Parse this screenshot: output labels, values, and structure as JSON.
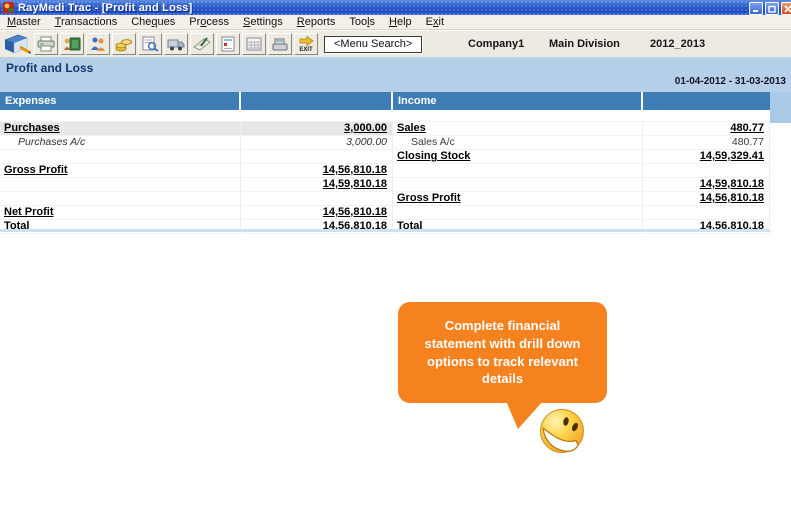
{
  "window": {
    "title": "RayMedi Trac - [Profit and Loss]"
  },
  "menu": {
    "items": [
      {
        "label": "Master",
        "accel": 0
      },
      {
        "label": "Transactions",
        "accel": 0
      },
      {
        "label": "Cheques",
        "accel": 3
      },
      {
        "label": "Process",
        "accel": 2
      },
      {
        "label": "Settings",
        "accel": 0
      },
      {
        "label": "Reports",
        "accel": 0
      },
      {
        "label": "Tools",
        "accel": 3
      },
      {
        "label": "Help",
        "accel": 0
      },
      {
        "label": "Exit",
        "accel": 1
      }
    ]
  },
  "toolbar": {
    "buttons": [
      "ledger-book",
      "print",
      "cash-payment",
      "customers",
      "money-bag",
      "search-document",
      "delivery-truck",
      "cheque-writing",
      "report-document",
      "calendar",
      "cash-register",
      "exit"
    ],
    "exit_label": "EXIT",
    "menu_search_label": "<Menu Search>",
    "company": "Company1",
    "division": "Main Division",
    "fiscal_year": "2012_2013"
  },
  "report": {
    "title": "Profit and Loss",
    "period": "01-04-2012 - 31-03-2013",
    "columns": {
      "expenses": "Expenses",
      "income": "Income"
    },
    "rows": [
      {
        "left": {
          "label": "Purchases",
          "value": "3,000.00",
          "style": "link",
          "highlight": true
        },
        "right": {
          "label": "Sales",
          "value": "480.77",
          "style": "link"
        }
      },
      {
        "left": {
          "label": "Purchases A/c",
          "value": "3,000.00",
          "style": "sub-italic"
        },
        "right": {
          "label": "Sales A/c",
          "value": "480.77",
          "style": "sub"
        }
      },
      {
        "left": null,
        "right": {
          "label": "Closing Stock",
          "value": "14,59,329.41",
          "style": "link"
        }
      },
      {
        "left": {
          "label": "Gross Profit",
          "value": "14,56,810.18",
          "style": "link"
        },
        "right": null
      },
      {
        "left": {
          "label": "",
          "value": "14,59,810.18",
          "style": "link"
        },
        "right": {
          "label": "",
          "value": "14,59,810.18",
          "style": "link"
        }
      },
      {
        "left": null,
        "right": {
          "label": "Gross Profit",
          "value": "14,56,810.18",
          "style": "link"
        }
      },
      {
        "left": {
          "label": "Net Profit",
          "value": "14,56,810.18",
          "style": "link"
        },
        "right": null
      },
      {
        "left": {
          "label": "Total",
          "value": "14,56,810.18",
          "style": "link"
        },
        "right": {
          "label": "Total",
          "value": "14,56,810.18",
          "style": "link"
        }
      }
    ]
  },
  "callout": {
    "text": "Complete financial statement with drill down options to track relevant details"
  },
  "colors": {
    "accent_orange": "#F5821E",
    "header_blue": "#3E7EB4",
    "titlebar_blue": "#2D5CCD",
    "panel_blue": "#B5D0E8",
    "highlight_gray": "#E7E7E7"
  }
}
